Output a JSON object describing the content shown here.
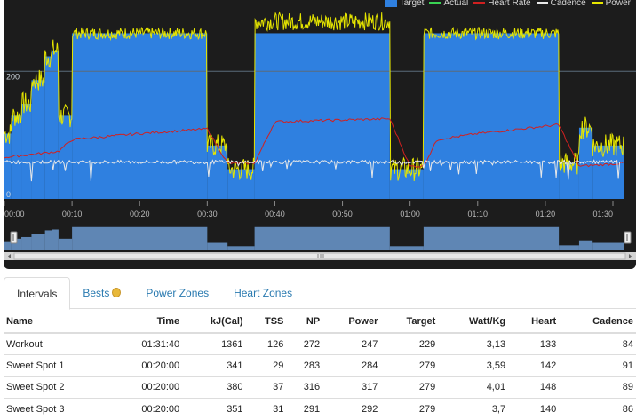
{
  "legend": [
    {
      "label": "Target",
      "kind": "box",
      "color": "#2f80e0"
    },
    {
      "label": "Actual",
      "kind": "line",
      "color": "#39d353"
    },
    {
      "label": "Heart Rate",
      "kind": "line",
      "color": "#d02020"
    },
    {
      "label": "Cadence",
      "kind": "line",
      "color": "#e8e8e8"
    },
    {
      "label": "Power",
      "kind": "line",
      "color": "#e6e600"
    }
  ],
  "chart_data": {
    "type": "area",
    "y_tick_labels": [
      "200",
      "0"
    ],
    "x_tick_labels": [
      "00:00",
      "00:10",
      "00:20",
      "00:30",
      "00:40",
      "00:50",
      "01:00",
      "01:10",
      "01:20",
      "01:30"
    ],
    "target_power_segments": [
      {
        "start_min": 0,
        "end_min": 1,
        "watts": 110
      },
      {
        "start_min": 1,
        "end_min": 2.5,
        "watts": 140
      },
      {
        "start_min": 2.5,
        "end_min": 4,
        "watts": 160
      },
      {
        "start_min": 4,
        "end_min": 6,
        "watts": 200
      },
      {
        "start_min": 6,
        "end_min": 7,
        "watts": 240
      },
      {
        "start_min": 7,
        "end_min": 8,
        "watts": 250
      },
      {
        "start_min": 8,
        "end_min": 10,
        "watts": 140
      },
      {
        "start_min": 10,
        "end_min": 30,
        "watts": 279
      },
      {
        "start_min": 30,
        "end_min": 33,
        "watts": 90
      },
      {
        "start_min": 33,
        "end_min": 37,
        "watts": 50
      },
      {
        "start_min": 37,
        "end_min": 57,
        "watts": 279
      },
      {
        "start_min": 57,
        "end_min": 62,
        "watts": 50
      },
      {
        "start_min": 62,
        "end_min": 82,
        "watts": 279
      },
      {
        "start_min": 82,
        "end_min": 85,
        "watts": 60
      },
      {
        "start_min": 85,
        "end_min": 87,
        "watts": 120
      },
      {
        "start_min": 87,
        "end_min": 91.7,
        "watts": 90
      }
    ],
    "duration_min": 91.7,
    "ylim_watts": [
      0,
      335
    ]
  },
  "tabs": [
    {
      "label": "Intervals",
      "active": true
    },
    {
      "label": "Bests",
      "active": false,
      "icon": "medal-icon"
    },
    {
      "label": "Power Zones",
      "active": false
    },
    {
      "label": "Heart Zones",
      "active": false
    }
  ],
  "table": {
    "headers": [
      "Name",
      "Time",
      "kJ(Cal)",
      "TSS",
      "NP",
      "Power",
      "Target",
      "Watt/Kg",
      "Heart",
      "Cadence"
    ],
    "rows": [
      [
        "Workout",
        "01:31:40",
        "1361",
        "126",
        "272",
        "247",
        "229",
        "3,13",
        "133",
        "84"
      ],
      [
        "Sweet Spot 1",
        "00:20:00",
        "341",
        "29",
        "283",
        "284",
        "279",
        "3,59",
        "142",
        "91"
      ],
      [
        "Sweet Spot 2",
        "00:20:00",
        "380",
        "37",
        "316",
        "317",
        "279",
        "4,01",
        "148",
        "89"
      ],
      [
        "Sweet Spot 3",
        "00:20:00",
        "351",
        "31",
        "291",
        "292",
        "279",
        "3,7",
        "140",
        "86"
      ]
    ]
  }
}
